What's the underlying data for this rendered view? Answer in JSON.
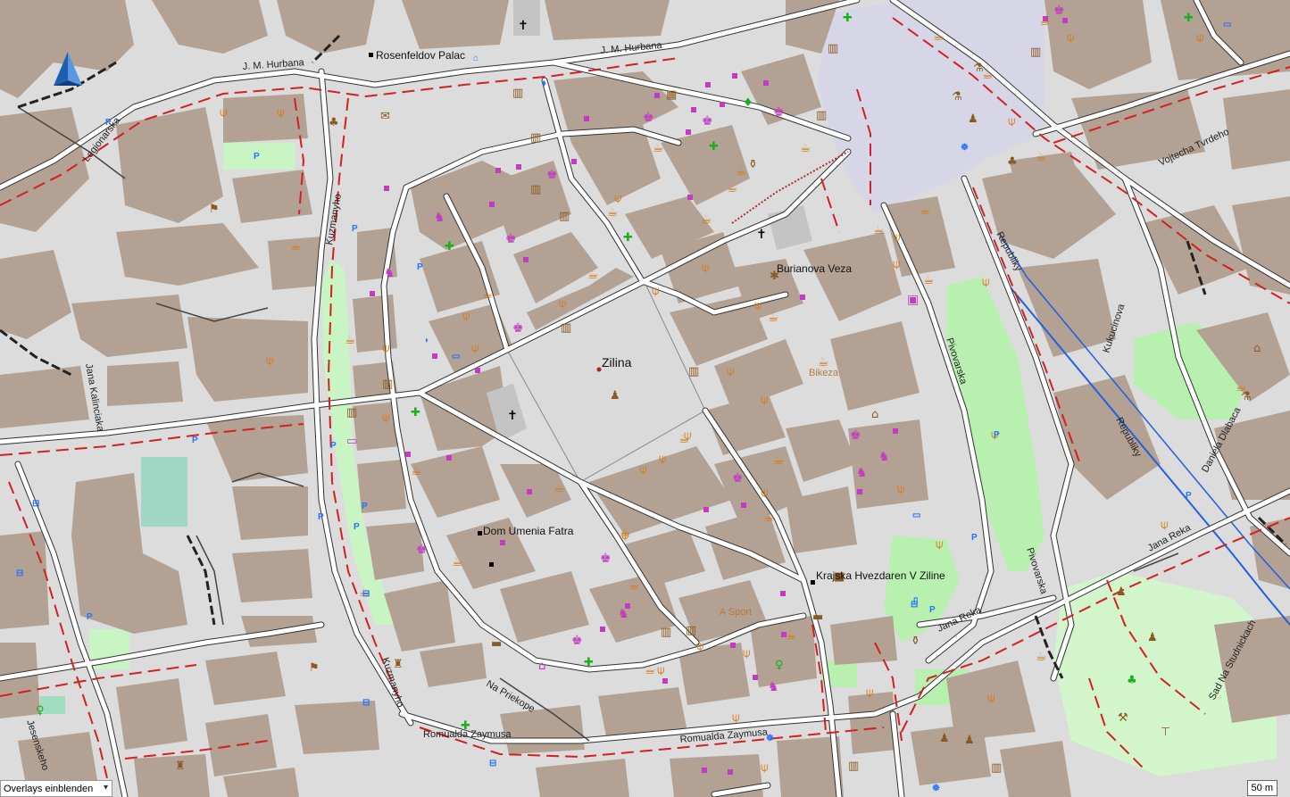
{
  "map": {
    "city_label": "Zilina",
    "places": [
      "Rosenfeldov Palac",
      "Burianova Veza",
      "Bikeza",
      "Dom Umenia Fatra",
      "Krajska Hvezdaren V Ziline",
      "A Sport"
    ],
    "streets": [
      "J. M. Hurbana",
      "J. M. Hurbana",
      "Legionarska",
      "Kuzmanyho",
      "Jana Kalinciaka",
      "Kuzmanyho",
      "Na Priekope",
      "Romualda Zaymusa",
      "Romualda Zaymusa",
      "Jesenskeho",
      "Pivovarska",
      "Pivovarska",
      "Republiky",
      "Republiky",
      "Kukucinova",
      "Vojtecha Tvrdeho",
      "Daniela Dlabaca",
      "Jana Reka",
      "Jana Reka",
      "Sad Na Studnickach"
    ]
  },
  "controls": {
    "overlay_label": "Overlays einblenden",
    "overlay_arrow": "▾",
    "scale_label": "50 m"
  },
  "colors": {
    "background": "#dcdcdc",
    "building": "#b3a193",
    "park": "#c9f5c5",
    "square": "#dadada",
    "pedestrian_area": "#d6d6e6",
    "road_casing": "#333333",
    "road_fill": "#ffffff",
    "boundary_dash": "#d32020",
    "river": "#2060e0",
    "poi_shop": "#c23cc2",
    "poi_food": "#d47a1a",
    "poi_health": "#19b019",
    "poi_parking": "#2673ff"
  }
}
